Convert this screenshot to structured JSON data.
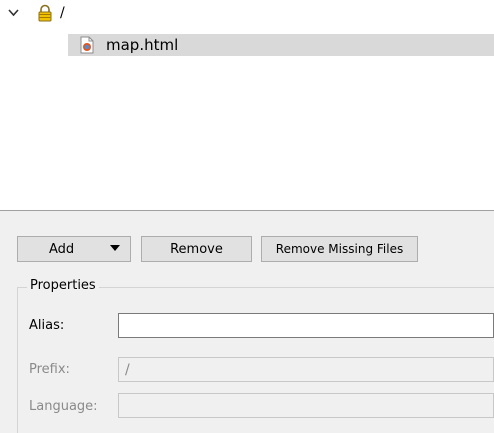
{
  "tree": {
    "root": {
      "label": "/",
      "icon": "lock-icon",
      "expanded": true
    },
    "files": [
      {
        "label": "map.html",
        "icon": "html-file-icon",
        "selected": true
      }
    ]
  },
  "toolbar": {
    "add_label": "Add",
    "remove_label": "Remove",
    "remove_missing_label": "Remove Missing Files"
  },
  "properties": {
    "title": "Properties",
    "alias": {
      "label": "Alias:",
      "value": ""
    },
    "prefix": {
      "label": "Prefix:",
      "value": "/"
    },
    "language": {
      "label": "Language:",
      "value": ""
    }
  },
  "colors": {
    "selection": "#d9d9d9",
    "background": "#f0f0f0"
  }
}
